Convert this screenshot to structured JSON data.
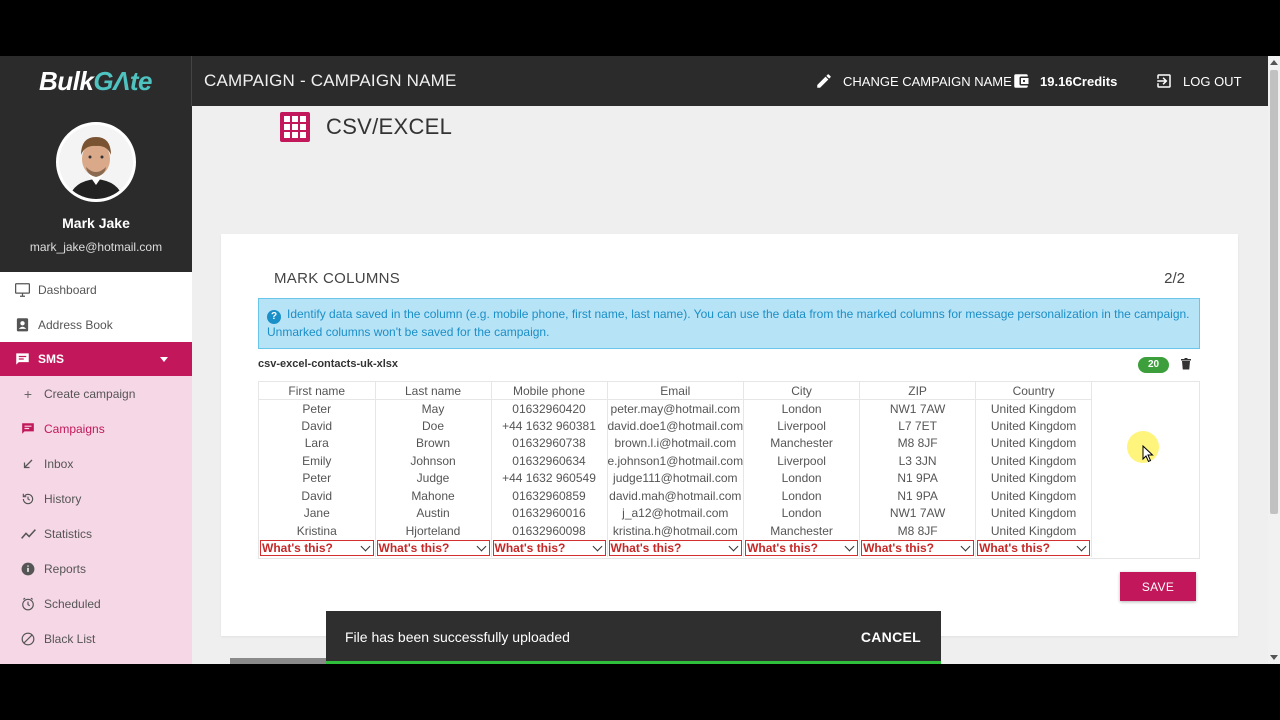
{
  "header": {
    "logo_part1": "Bulk",
    "logo_part2": "GΛte",
    "title": "CAMPAIGN  - CAMPAIGN NAME",
    "change_name": "CHANGE CAMPAIGN NAME",
    "credits": "19.16Credits",
    "logout": "LOG OUT"
  },
  "user": {
    "name": "Mark Jake",
    "email": "mark_jake@hotmail.com"
  },
  "sidebar": {
    "items": [
      {
        "label": "Dashboard",
        "icon": "monitor-icon"
      },
      {
        "label": "Address Book",
        "icon": "address-book-icon"
      },
      {
        "label": "SMS",
        "icon": "chat-icon"
      },
      {
        "label": "Create campaign",
        "icon": "plus-icon"
      },
      {
        "label": "Campaigns",
        "icon": "chat-icon"
      },
      {
        "label": "Inbox",
        "icon": "arrow-in-icon"
      },
      {
        "label": "History",
        "icon": "history-icon"
      },
      {
        "label": "Statistics",
        "icon": "chart-line-icon"
      },
      {
        "label": "Reports",
        "icon": "info-icon"
      },
      {
        "label": "Scheduled",
        "icon": "clock-icon"
      },
      {
        "label": "Black List",
        "icon": "block-icon"
      }
    ]
  },
  "main": {
    "page_title": "CSV/EXCEL",
    "step_title": "MARK COLUMNS",
    "step_count": "2/2",
    "info_text": "Identify data saved in the column (e.g. mobile phone, first name, last name). You can use the data from the marked columns for message personalization in the campaign. Unmarked columns won't be saved for the campaign.",
    "filename": "csv-excel-contacts-uk-xlsx",
    "row_count": "20",
    "save_label": "SAVE"
  },
  "table": {
    "headers": [
      "First name",
      "Last name",
      "Mobile phone",
      "Email",
      "City",
      "ZIP",
      "Country"
    ],
    "rows": [
      [
        "Peter",
        "May",
        "01632960420",
        "peter.may@hotmail.com",
        "London",
        "NW1 7AW",
        "United Kingdom"
      ],
      [
        "David",
        "Doe",
        "+44 1632 960381",
        "david.doe1@hotmail.com",
        "Liverpool",
        "L7 7ET",
        "United Kingdom"
      ],
      [
        "Lara",
        "Brown",
        "01632960738",
        "brown.l.i@hotmail.com",
        "Manchester",
        "M8 8JF",
        "United Kingdom"
      ],
      [
        "Emily",
        "Johnson",
        "01632960634",
        "e.johnson1@hotmail.com",
        "Liverpool",
        "L3 3JN",
        "United Kingdom"
      ],
      [
        "Peter",
        "Judge",
        "+44 1632 960549",
        "judge111@hotmail.com",
        "London",
        "N1 9PA",
        "United Kingdom"
      ],
      [
        "David",
        "Mahone",
        "01632960859",
        "david.mah@hotmail.com",
        "London",
        "N1 9PA",
        "United Kingdom"
      ],
      [
        "Jane",
        "Austin",
        "01632960016",
        "j_a12@hotmail.com",
        "London",
        "NW1 7AW",
        "United Kingdom"
      ],
      [
        "Kristina",
        "Hjorteland",
        "01632960098",
        "kristina.h@hotmail.com",
        "Manchester",
        "M8 8JF",
        "United Kingdom"
      ]
    ],
    "select_placeholder": "What's this?"
  },
  "snackbar": {
    "message": "File has been successfully uploaded",
    "action": "CANCEL"
  },
  "colors": {
    "accent": "#c2185b",
    "header_bg": "#2b2b2b",
    "sidebar_bg": "#f6d7e6",
    "info_bg": "#b7e3f6",
    "info_text": "#1b8fc7",
    "success": "#3c9f3c"
  }
}
